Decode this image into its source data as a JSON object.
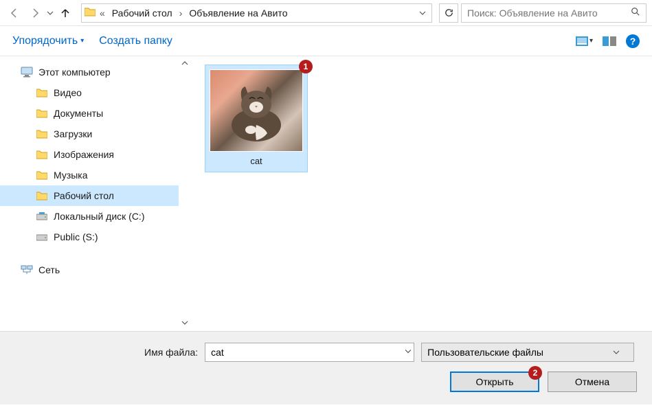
{
  "breadcrumb": {
    "parent": "Рабочий стол",
    "current": "Объявление на Авито"
  },
  "search": {
    "placeholder": "Поиск: Объявление на Авито"
  },
  "toolbar": {
    "organize": "Упорядочить",
    "new_folder": "Создать папку"
  },
  "sidebar": {
    "this_pc": "Этот компьютер",
    "items": [
      {
        "label": "Видео",
        "kind": "lib-video"
      },
      {
        "label": "Документы",
        "kind": "lib-docs"
      },
      {
        "label": "Загрузки",
        "kind": "lib-downloads"
      },
      {
        "label": "Изображения",
        "kind": "lib-pictures"
      },
      {
        "label": "Музыка",
        "kind": "lib-music"
      },
      {
        "label": "Рабочий стол",
        "kind": "lib-desktop",
        "selected": true
      },
      {
        "label": "Локальный диск (C:)",
        "kind": "drive"
      },
      {
        "label": "Public (S:)",
        "kind": "netdrive"
      }
    ],
    "network": "Сеть"
  },
  "files": [
    {
      "label": "cat",
      "badge": "1"
    }
  ],
  "dialog": {
    "filename_label": "Имя файла:",
    "filename_value": "cat",
    "filetype_value": "Пользовательские файлы",
    "open": "Открыть",
    "cancel": "Отмена",
    "open_badge": "2"
  }
}
